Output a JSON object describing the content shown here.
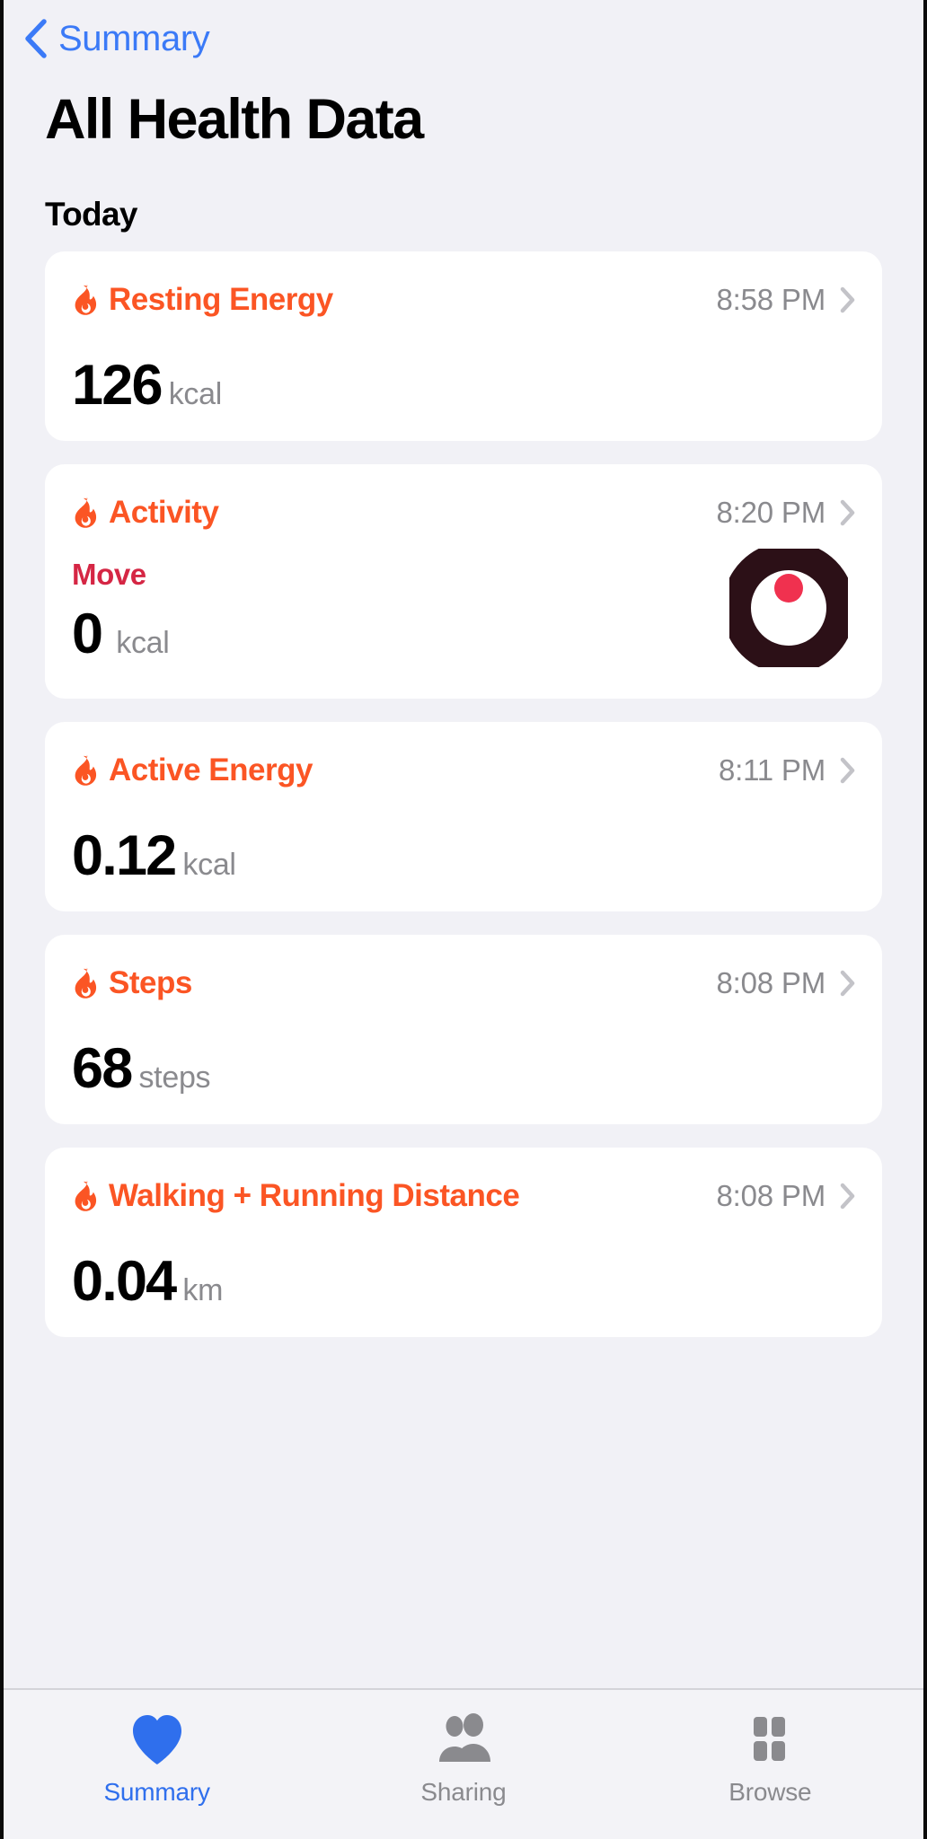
{
  "nav": {
    "back_label": "Summary",
    "back_icon": "chevron-left-icon"
  },
  "header": {
    "title": "All Health Data",
    "section": "Today"
  },
  "colors": {
    "accent_orange": "#fb5524",
    "move_red": "#d52644",
    "tab_blue": "#2f6fed",
    "link_blue": "#3b7af7",
    "secondary_gray": "#8a8a8e",
    "background": "#f1f1f6",
    "card": "#ffffff",
    "ring_track": "#2c1017",
    "ring_progress": "#f0314f"
  },
  "cards": [
    {
      "type": "metric",
      "icon": "flame-icon",
      "name": "Resting Energy",
      "time": "8:58 PM",
      "chevron": "chevron-right-icon",
      "value": "126",
      "unit": "kcal"
    },
    {
      "type": "activity",
      "icon": "flame-icon",
      "name": "Activity",
      "time": "8:20 PM",
      "chevron": "chevron-right-icon",
      "ring_label": "Move",
      "value": "0",
      "unit": "kcal",
      "ring_icon": "activity-ring-icon"
    },
    {
      "type": "metric",
      "icon": "flame-icon",
      "name": "Active Energy",
      "time": "8:11 PM",
      "chevron": "chevron-right-icon",
      "value": "0.12",
      "unit": "kcal"
    },
    {
      "type": "metric",
      "icon": "flame-icon",
      "name": "Steps",
      "time": "8:08 PM",
      "chevron": "chevron-right-icon",
      "value": "68",
      "unit": "steps"
    },
    {
      "type": "metric",
      "icon": "flame-icon",
      "name": "Walking + Running Distance",
      "time": "8:08 PM",
      "chevron": "chevron-right-icon",
      "value": "0.04",
      "unit": "km"
    }
  ],
  "tabbar": {
    "items": [
      {
        "label": "Summary",
        "icon": "heart-icon",
        "active": true
      },
      {
        "label": "Sharing",
        "icon": "people-icon",
        "active": false
      },
      {
        "label": "Browse",
        "icon": "grid-icon",
        "active": false
      }
    ]
  }
}
